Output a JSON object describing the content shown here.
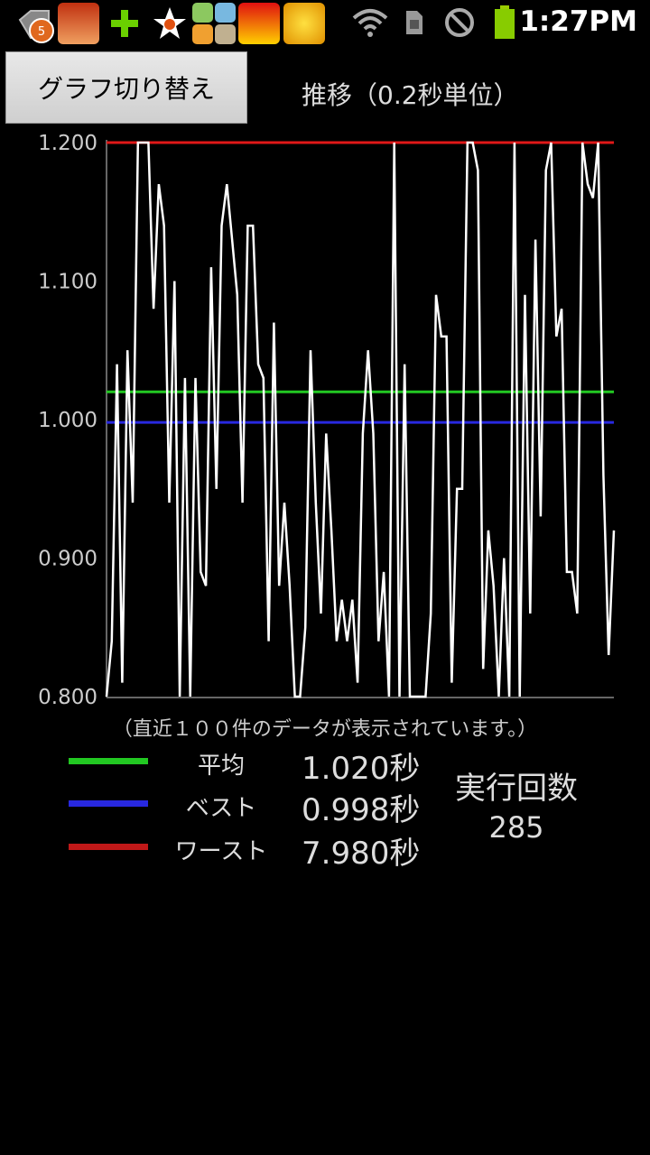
{
  "status_bar": {
    "notification_count": "5",
    "time": "1:27PM",
    "icons": [
      "notification-badge-icon",
      "app-icon-hero",
      "plus-icon",
      "star-icon",
      "app-icon-grid",
      "uno-icon",
      "slot-icon",
      "wifi-icon",
      "sim-icon",
      "blocked-icon",
      "battery-icon"
    ]
  },
  "header": {
    "switch_button": "グラフ切り替え",
    "title": "推移（0.2秒単位）"
  },
  "chart_data": {
    "type": "line",
    "ylim": [
      0.8,
      1.2
    ],
    "y_ticks": [
      "1.200",
      "1.100",
      "1.000",
      "0.900",
      "0.800"
    ],
    "grid": false,
    "reference_lines": [
      {
        "name": "平均",
        "value": 1.02,
        "color": "#22c822"
      },
      {
        "name": "ベスト",
        "value": 0.998,
        "color": "#2828e0"
      },
      {
        "name": "ワースト",
        "value": 1.2,
        "color": "#e01818"
      }
    ],
    "series": [
      {
        "color": "#ffffff",
        "values": [
          0.8,
          0.84,
          1.04,
          0.81,
          1.05,
          0.94,
          1.2,
          1.2,
          1.2,
          1.08,
          1.17,
          1.14,
          0.94,
          1.1,
          0.8,
          1.03,
          0.8,
          1.03,
          0.89,
          0.88,
          1.11,
          0.95,
          1.14,
          1.17,
          1.13,
          1.09,
          0.94,
          1.14,
          1.14,
          1.04,
          1.03,
          0.84,
          1.07,
          0.88,
          0.94,
          0.88,
          0.8,
          0.8,
          0.85,
          1.05,
          0.94,
          0.86,
          0.99,
          0.92,
          0.84,
          0.87,
          0.84,
          0.87,
          0.81,
          0.99,
          1.05,
          0.99,
          0.84,
          0.89,
          0.8,
          1.2,
          0.8,
          1.04,
          0.8,
          0.8,
          0.8,
          0.8,
          0.86,
          1.09,
          1.06,
          1.06,
          0.81,
          0.95,
          0.95,
          1.2,
          1.2,
          1.18,
          0.82,
          0.92,
          0.88,
          0.8,
          0.9,
          0.8,
          1.2,
          0.8,
          1.09,
          0.86,
          1.13,
          0.93,
          1.18,
          1.2,
          1.06,
          1.08,
          0.89,
          0.89,
          0.86,
          1.2,
          1.17,
          1.16,
          1.2,
          0.96,
          0.83,
          0.92
        ]
      }
    ]
  },
  "note": "（直近１００件のデータが表示されています。）",
  "legend": {
    "average_label": "平均",
    "average_value": "1.020秒",
    "average_color": "#22c822",
    "best_label": "ベスト",
    "best_value": "0.998秒",
    "best_color": "#2828e0",
    "worst_label": "ワースト",
    "worst_value": "7.980秒",
    "worst_color": "#c01818"
  },
  "runs": {
    "label": "実行回数",
    "value": "285"
  }
}
